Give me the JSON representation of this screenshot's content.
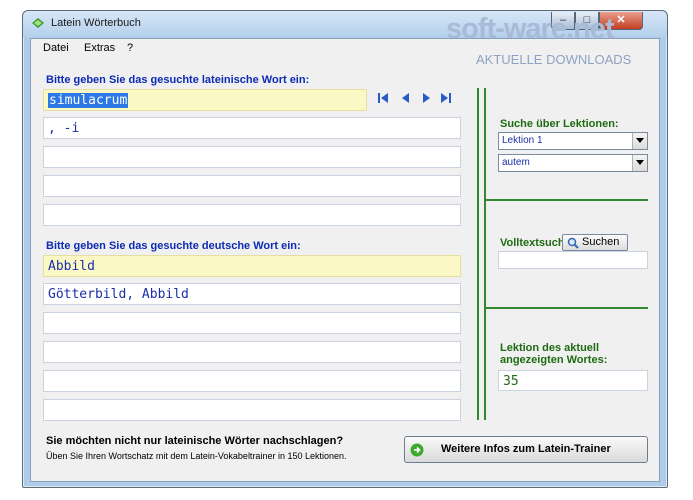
{
  "window": {
    "title": "Latein Wörterbuch"
  },
  "menu": [
    "Datei",
    "Extras",
    "?"
  ],
  "latin": {
    "label": "Bitte geben Sie das gesuchte lateinische Wort ein:",
    "input": "simulacrum",
    "results": [
      ", -i",
      "",
      "",
      ""
    ]
  },
  "german": {
    "label": "Bitte geben Sie das gesuchte deutsche Wort ein:",
    "input": "Abbild",
    "results": [
      "Götterbild, Abbild",
      "",
      "",
      "",
      ""
    ]
  },
  "nav_icons": [
    "first-icon",
    "prev-icon",
    "next-icon",
    "last-icon"
  ],
  "lesson_search": {
    "label": "Suche über Lektionen:",
    "lesson_selected": "Lektion 1",
    "word_selected": "autem"
  },
  "fulltext": {
    "label": "Volltextsuche:",
    "button": "Suchen",
    "input": ""
  },
  "current_lesson": {
    "label_line1": "Lektion des aktuell",
    "label_line2": "angezeigten Wortes:",
    "value": "35"
  },
  "footer": {
    "question": "Sie möchten nicht nur lateinische Wörter nachschlagen?",
    "sub": "Üben Sie Ihren Wortschatz mit dem Latein-Vokabeltrainer in 150 Lektionen.",
    "button": "Weitere Infos zum Latein-Trainer"
  },
  "watermark": {
    "logo": "soft-ware.net",
    "sub": "AKTUELLE DOWNLOADS"
  },
  "colors": {
    "label_blue": "#0d2bb5",
    "label_green": "#1e6b12",
    "divider_green": "#2f8a2f",
    "input_yellow": "#fcf8c6"
  }
}
